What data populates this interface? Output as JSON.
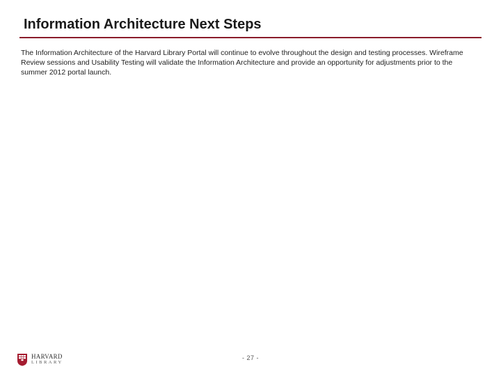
{
  "slide": {
    "title": "Information Architecture Next Steps",
    "body": "The Information Architecture of the Harvard Library Portal will continue to evolve throughout the design and testing processes. Wireframe Review sessions and Usability Testing will validate the Information Architecture and provide an opportunity for adjustments prior to the summer 2012 portal launch."
  },
  "footer": {
    "page_number": "- 27 -"
  },
  "logo": {
    "institution": "HARVARD",
    "unit": "LIBRARY"
  },
  "colors": {
    "accent": "#8a1c2b",
    "shield": "#a51c30"
  }
}
